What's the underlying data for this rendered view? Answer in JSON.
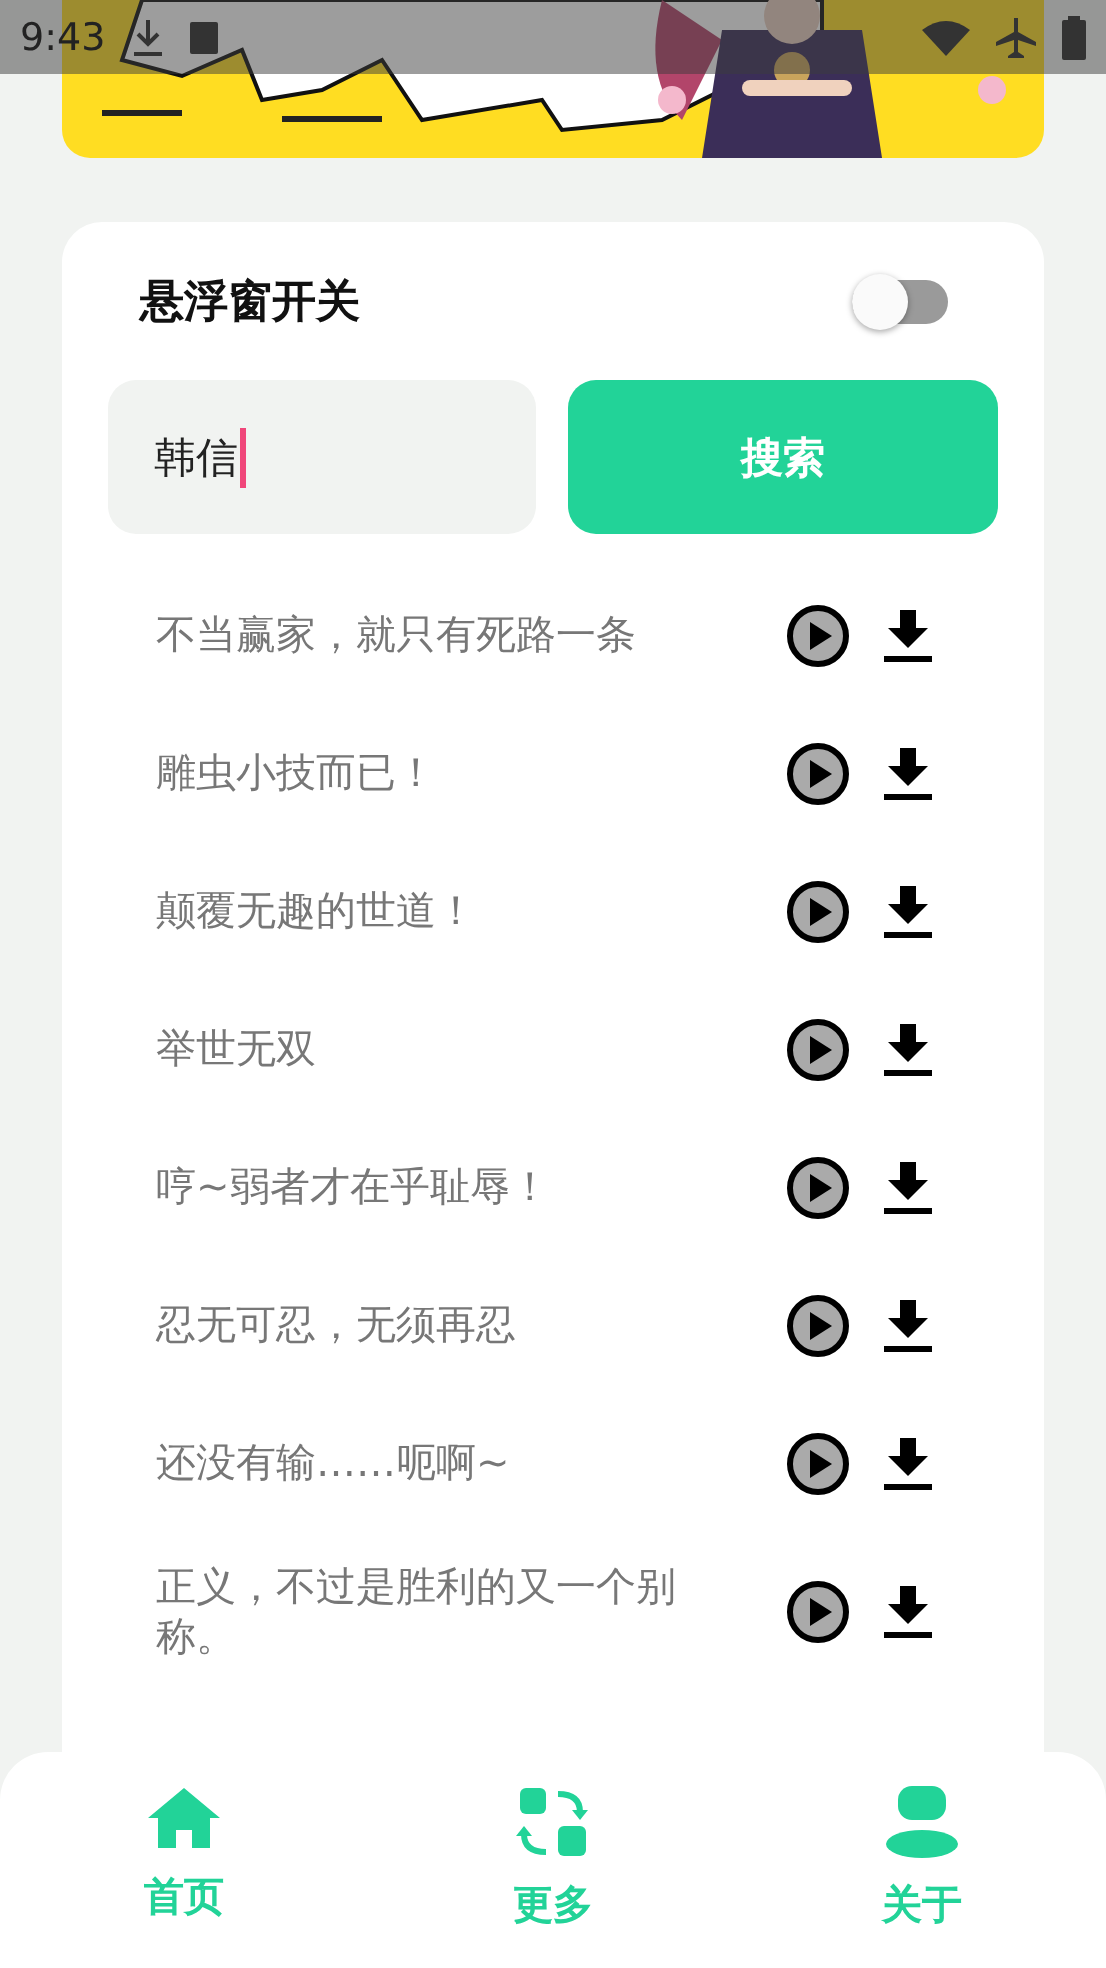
{
  "status_bar": {
    "time": "9:43"
  },
  "floating_window": {
    "label": "悬浮窗开关",
    "on": false
  },
  "search": {
    "value": "韩信",
    "button": "搜索"
  },
  "quotes": [
    {
      "text": "不当赢家，就只有死路一条"
    },
    {
      "text": "雕虫小技而已！"
    },
    {
      "text": "颠覆无趣的世道！"
    },
    {
      "text": "举世无双"
    },
    {
      "text": "哼~弱者才在乎耻辱！"
    },
    {
      "text": "忍无可忍，无须再忍"
    },
    {
      "text": "还没有输……呃啊~"
    },
    {
      "text": "正义，不过是胜利的又一个别称。"
    }
  ],
  "nav": [
    {
      "kind": "home",
      "label": "首页"
    },
    {
      "kind": "more",
      "label": "更多"
    },
    {
      "kind": "about",
      "label": "关于"
    }
  ]
}
